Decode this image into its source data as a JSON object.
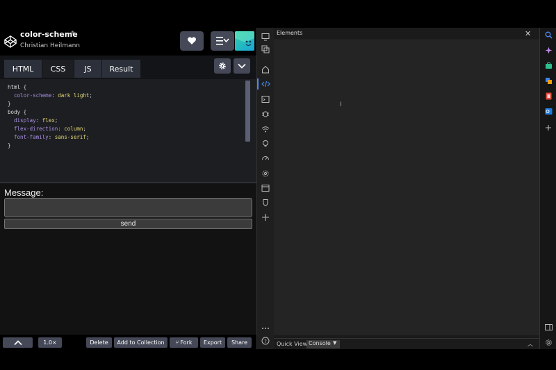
{
  "pen": {
    "title": "color-scheme",
    "author": "Christian Heilmann"
  },
  "tabs": [
    {
      "label": "HTML"
    },
    {
      "label": "CSS"
    },
    {
      "label": "JS"
    },
    {
      "label": "Result"
    }
  ],
  "css_code": {
    "l1_sel": "html {",
    "l2_prop": "color-scheme",
    "l2_val": "dark light",
    "l3": "}",
    "l4_sel": "body {",
    "l5_prop": "display",
    "l5_val": "flex",
    "l6_prop": "flex-direction",
    "l6_val": "column",
    "l7_prop": "font-family",
    "l7_val": "sans-serif",
    "l8": "}"
  },
  "result": {
    "message_label": "Message:",
    "send_label": "send"
  },
  "footer": {
    "zoom": "1.0×",
    "delete": "Delete",
    "add_collection": "Add to Collection",
    "fork": "Fork",
    "export": "Export",
    "share": "Share"
  },
  "devtools": {
    "panel_title": "Elements",
    "quick_view_label": "Quick View:",
    "quick_view_value": "Console"
  },
  "colors": {
    "accent": "#4c8cf5",
    "button_bg": "#444857"
  }
}
